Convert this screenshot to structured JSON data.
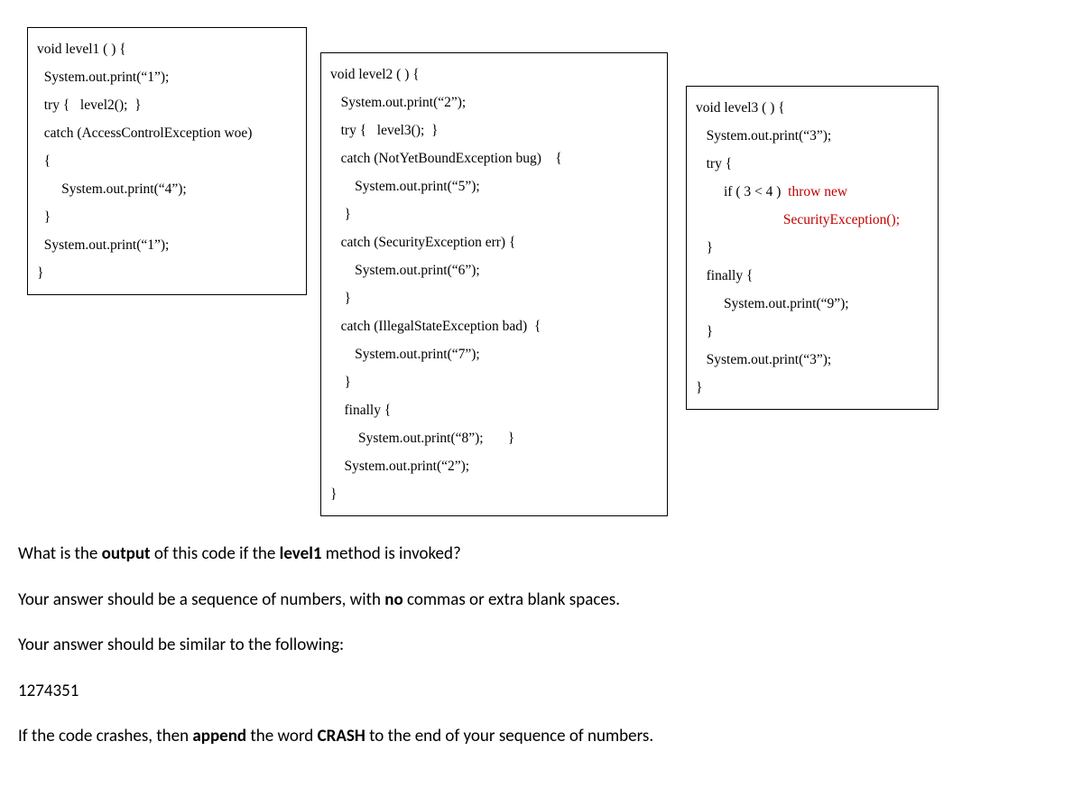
{
  "box1": {
    "l1": "void level1 ( ) {",
    "l2": "  System.out.print(“1”);",
    "l3": "  try {   level2();  }",
    "l4": "  catch (AccessControlException woe)",
    "l5": "  {",
    "l6": "       System.out.print(“4”);",
    "l7": "  }",
    "l8": "  System.out.print(“1”);",
    "l9": "}"
  },
  "box2": {
    "l1": "void level2 ( ) {",
    "l2": "   System.out.print(“2”);",
    "l3": "   try {   level3();  }",
    "l4": "   catch (NotYetBoundException bug)    {",
    "l5": "       System.out.print(“5”);",
    "l6": "    }",
    "l7": "   catch (SecurityException err) {",
    "l8": "       System.out.print(“6”);",
    "l9": "    }",
    "l10": "   catch (IllegalStateException bad)  {",
    "l11": "       System.out.print(“7”);",
    "l12": "    }",
    "l13": "    finally {",
    "l14": "        System.out.print(“8”);       }",
    "l15": "    System.out.print(“2”);",
    "l16": "}"
  },
  "box3": {
    "l1": "void level3 ( ) {",
    "l2": "   System.out.print(“3”);",
    "l3": "   try {",
    "l4a": "        if ( 3 < 4 )  ",
    "l4b": "throw new",
    "l5": "                         SecurityException();",
    "l6": "   }",
    "l7": "   finally {",
    "l8": "        System.out.print(“9”);",
    "l9": "   }",
    "l10": "   System.out.print(“3”);",
    "l11": "}"
  },
  "q": {
    "p1a": "What is the ",
    "p1b": "output",
    "p1c": " of this code if the ",
    "p1d": "level1",
    "p1e": " method is invoked?",
    "p2a": "Your answer should be a sequence of numbers, with ",
    "p2b": "no",
    "p2c": " commas or extra blank spaces.",
    "p3": "Your answer should be similar to the following:",
    "p4": "1274351",
    "p5a": "If the code crashes, then ",
    "p5b": "append",
    "p5c": " the word ",
    "p5d": "CRASH",
    "p5e": " to the end of your sequence of numbers."
  }
}
